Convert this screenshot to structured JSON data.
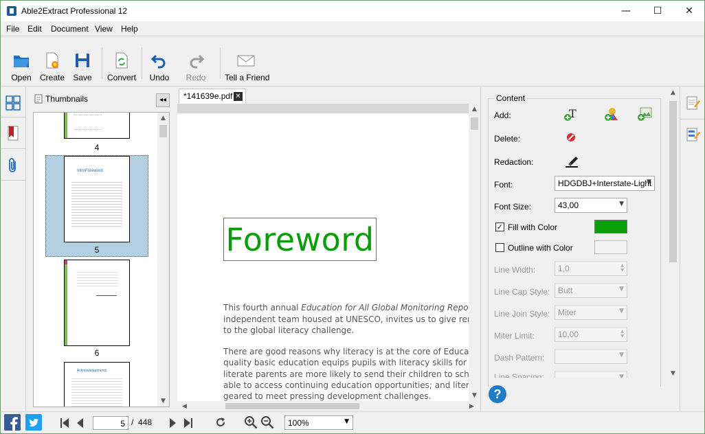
{
  "window": {
    "title": "Able2Extract Professional 12",
    "minimize": "—",
    "maximize": "☐",
    "close": "✕"
  },
  "menu": [
    "File",
    "Edit",
    "Document",
    "View",
    "Help"
  ],
  "toolbar": {
    "open": "Open",
    "create": "Create",
    "save": "Save",
    "convert": "Convert",
    "undo": "Undo",
    "redo": "Redo",
    "tell_friend": "Tell a Friend"
  },
  "thumbnails": {
    "header": "Thumbnails",
    "collapse": "◂◂",
    "pages": [
      {
        "number": "4"
      },
      {
        "number": "5",
        "heading": "IntroForeword",
        "selected": true
      },
      {
        "number": "6"
      },
      {
        "heading": "Acknowledgements"
      }
    ]
  },
  "document": {
    "tab": "*141639e.pdf",
    "tab_close": "✕",
    "heading": "Foreword",
    "paragraph1": [
      "This fourth annual Education for All Global Monitoring Report, pro",
      "independent team housed at UNESCO, invites us to give renewed a",
      "to the global literacy challenge."
    ],
    "paragraph2": [
      "There are good reasons why literacy is at the core of Education for",
      "quality basic education equips pupils with literacy skills for life and",
      "literate parents are more likely to send their children to school; lit",
      "able to access continuing education opportunities; and literate soc",
      "geared to meet pressing development challenges."
    ]
  },
  "properties": {
    "group": "Content",
    "add": "Add:",
    "delete": "Delete:",
    "redaction": "Redaction:",
    "font_label": "Font:",
    "font_value": "HDGDBJ+Interstate-Light",
    "font_size_label": "Font Size:",
    "font_size_value": "43,00",
    "fill_label": "Fill with Color",
    "fill_checked": true,
    "fill_color": "#0a9d0a",
    "outline_label": "Outline with Color",
    "outline_checked": false,
    "line_width_label": "Line Width:",
    "line_width_value": "1,0",
    "line_cap_label": "Line Cap Style:",
    "line_cap_value": "Butt",
    "line_join_label": "Line Join Style:",
    "line_join_value": "Miter",
    "miter_limit_label": "Miter Limit:",
    "miter_limit_value": "10,00",
    "dash_label": "Dash Pattern:",
    "line_spacing_label": "Line Spacing:",
    "help": "?"
  },
  "statusbar": {
    "current_page": "5",
    "page_separator": "/",
    "total_pages": "448",
    "zoom": "100%"
  },
  "colors": {
    "accent_blue": "#1e7bc7",
    "selection": "#b3cfe2",
    "brand_facebook": "#3b5998",
    "brand_twitter": "#1da1f2"
  }
}
